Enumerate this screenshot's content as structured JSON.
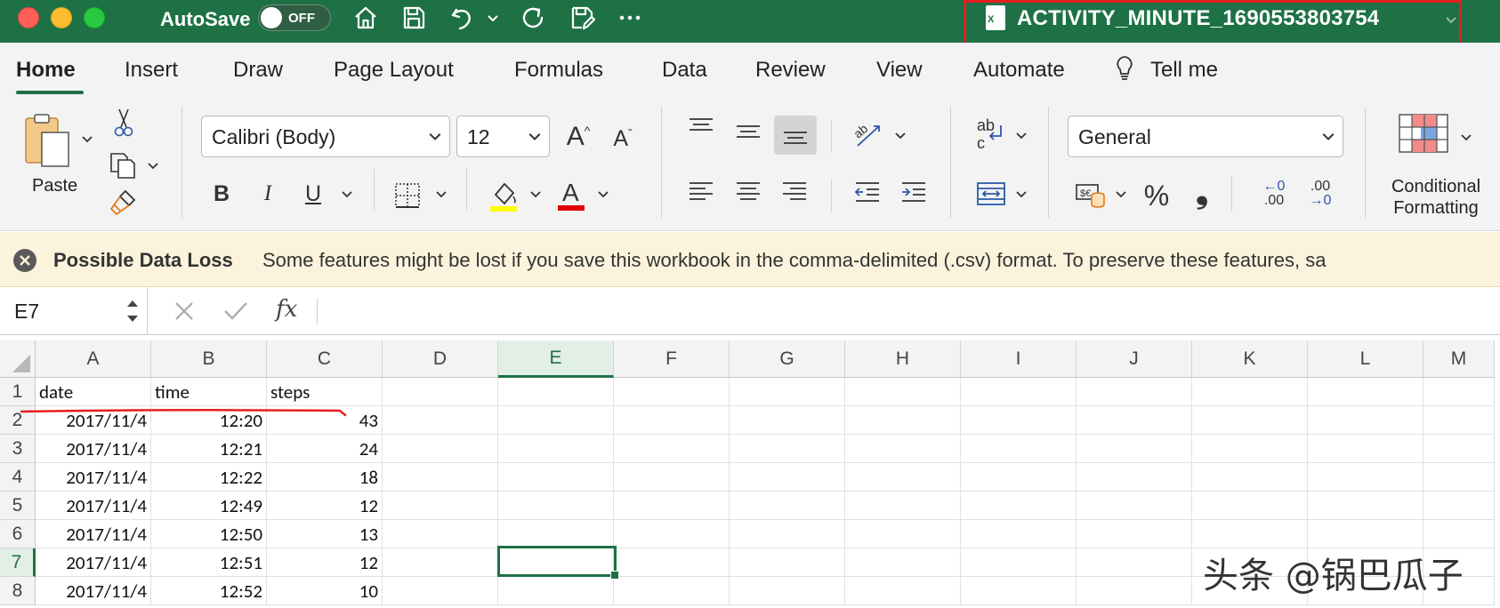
{
  "titlebar": {
    "autosave_label": "AutoSave",
    "autosave_state": "OFF",
    "document_title": "ACTIVITY_MINUTE_1690553803754",
    "bg_color": "#1e7145",
    "icons": [
      "home-icon",
      "save-icon",
      "undo-icon",
      "redo-icon",
      "save-as-icon",
      "more-icon"
    ]
  },
  "ribbon_tabs": [
    "Home",
    "Insert",
    "Draw",
    "Page Layout",
    "Formulas",
    "Data",
    "Review",
    "View",
    "Automate",
    "Tell me"
  ],
  "ribbon": {
    "paste_label": "Paste",
    "font_name": "Calibri (Body)",
    "font_size": "12",
    "bold": "B",
    "italic": "I",
    "underline": "U",
    "number_format": "General",
    "percent": "%",
    "comma": "❟",
    "inc_decimal_top": "←0",
    "inc_decimal_bottom": ".00",
    "dec_decimal_top": ".00",
    "dec_decimal_bottom": "→0",
    "wrap_ab": "ab",
    "wrap_c": "c",
    "conditional_formatting": [
      "Conditional",
      "Formatting"
    ],
    "fill_color": "#ffff00",
    "font_color": "#e00000"
  },
  "message_bar": {
    "title": "Possible Data Loss",
    "text": "Some features might be lost if you save this workbook in the comma-delimited (.csv) format. To preserve these features, sa"
  },
  "formula_bar": {
    "name_box": "E7",
    "fx_label": "fx",
    "value": ""
  },
  "sheet": {
    "columns": [
      "A",
      "B",
      "C",
      "D",
      "E",
      "F",
      "G",
      "H",
      "I",
      "J",
      "K",
      "L",
      "M"
    ],
    "selected_column": "E",
    "selected_row": "7",
    "rows": [
      {
        "num": "1",
        "cells": [
          "date",
          "time",
          "steps"
        ]
      },
      {
        "num": "2",
        "cells": [
          "2017/11/4",
          "12:20",
          "43"
        ]
      },
      {
        "num": "3",
        "cells": [
          "2017/11/4",
          "12:21",
          "24"
        ]
      },
      {
        "num": "4",
        "cells": [
          "2017/11/4",
          "12:22",
          "18"
        ]
      },
      {
        "num": "5",
        "cells": [
          "2017/11/4",
          "12:49",
          "12"
        ]
      },
      {
        "num": "6",
        "cells": [
          "2017/11/4",
          "12:50",
          "13"
        ]
      },
      {
        "num": "7",
        "cells": [
          "2017/11/4",
          "12:51",
          "12"
        ]
      },
      {
        "num": "8",
        "cells": [
          "2017/11/4",
          "12:52",
          "10"
        ]
      }
    ]
  },
  "watermark": "头条 @锅巴瓜子"
}
